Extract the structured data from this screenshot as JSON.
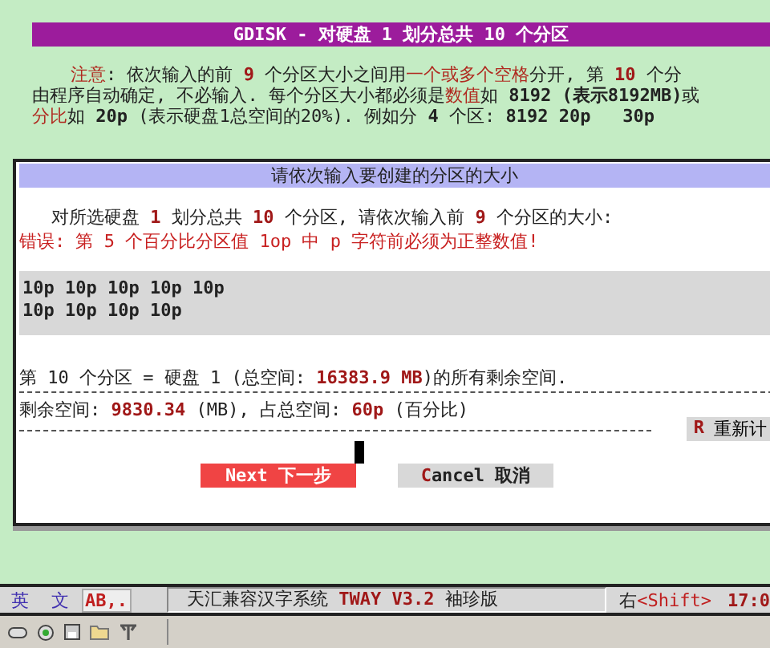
{
  "title_bar": {
    "text": "GDISK - 对硬盘 1 划分总共 10 个分区"
  },
  "notice": {
    "lines": [
      [
        {
          "kind": "label",
          "text": "注意"
        },
        {
          "kind": "plain",
          "text": ": 依次输入的前 "
        },
        {
          "kind": "number",
          "text": "9"
        },
        {
          "kind": "plain",
          "text": " 个分区大小之间用"
        },
        {
          "kind": "highlight",
          "text": "一个或多个空格"
        },
        {
          "kind": "plain",
          "text": "分开, 第 "
        },
        {
          "kind": "number",
          "text": "10"
        },
        {
          "kind": "plain",
          "text": " 个分"
        }
      ],
      [
        {
          "kind": "plain",
          "text": "由程序自动确定, 不必输入. 每个分区大小都必须是"
        },
        {
          "kind": "highlight",
          "text": "数值"
        },
        {
          "kind": "plain",
          "text": "如 "
        },
        {
          "kind": "code",
          "text": "8192 (表示8192MB)"
        },
        {
          "kind": "plain",
          "text": "或"
        }
      ],
      [
        {
          "kind": "highlight",
          "text": "分比"
        },
        {
          "kind": "plain",
          "text": "如 "
        },
        {
          "kind": "code",
          "text": "20p"
        },
        {
          "kind": "plain",
          "text": " (表示硬盘1总空间的20%). 例如分 "
        },
        {
          "kind": "code",
          "text": "4"
        },
        {
          "kind": "plain",
          "text": " 个区: "
        },
        {
          "kind": "code",
          "text": "8192 20p   30p"
        }
      ]
    ]
  },
  "dialog": {
    "title": "请依次输入要创建的分区的大小",
    "prompt": [
      {
        "kind": "plain",
        "text": "对所选硬盘 "
      },
      {
        "kind": "number",
        "text": "1"
      },
      {
        "kind": "plain",
        "text": " 划分总共 "
      },
      {
        "kind": "number",
        "text": "10"
      },
      {
        "kind": "plain",
        "text": " 个分区, 请依次输入前 "
      },
      {
        "kind": "number",
        "text": "9"
      },
      {
        "kind": "plain",
        "text": " 个分区的大小:"
      }
    ],
    "error": "错误: 第 5 个百分比分区值 1op 中 p 字符前必须为正整数值!",
    "input": {
      "value_lines": [
        "10p 10p 10p 10p 10p",
        "10p 10p 10p 10p"
      ]
    },
    "last_partition": [
      {
        "kind": "plain",
        "text": "第 10 个分区 = 硬盘 1 (总空间: "
      },
      {
        "kind": "number",
        "text": "16383.9 MB"
      },
      {
        "kind": "plain",
        "text": ")的所有剩余空间."
      }
    ],
    "remaining": [
      {
        "kind": "plain",
        "text": "剩余空间: "
      },
      {
        "kind": "number",
        "text": "9830.34"
      },
      {
        "kind": "plain",
        "text": " (MB), 占总空间: "
      },
      {
        "kind": "number",
        "text": "60p"
      },
      {
        "kind": "plain",
        "text": " (百分比)"
      }
    ],
    "recalc_button": {
      "hotkey": "R",
      "label": "重新计"
    },
    "buttons": [
      {
        "label": "Next 下一步",
        "focused": true
      },
      {
        "hotkey": "C",
        "label": "ancel 取消",
        "focused": false
      }
    ]
  },
  "taskbar": {
    "mode": [
      "英",
      "文"
    ],
    "charset": "AB,.",
    "system": [
      {
        "kind": "plain",
        "text": "天汇兼容汉字系统 "
      },
      {
        "kind": "number",
        "text": "TWAY V3.2"
      },
      {
        "kind": "plain",
        "text": " 袖珍版"
      }
    ],
    "shift": {
      "side": "右",
      "key": "<Shift>"
    },
    "time": "17:0"
  }
}
